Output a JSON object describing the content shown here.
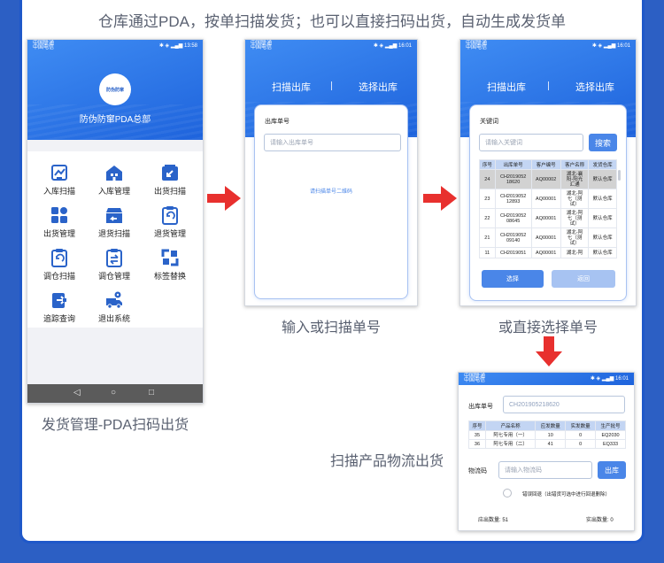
{
  "headline": "仓库通过PDA，按单扫描发货；也可以直接扫码出货，自动生成发货单",
  "colors": {
    "brand_blue": "#1f58c9",
    "accent_red": "#e8302e",
    "button_blue": "#4a86e8"
  },
  "captions": {
    "phone1": "发货管理-PDA扫码出货",
    "phone2": "输入或扫描单号",
    "phone3": "或直接选择单号",
    "phone4": "扫描产品物流出货"
  },
  "phone1": {
    "status_left1": "中国联通",
    "status_left2": "中国电信",
    "status_right": "✱ ◈ ▂▄▆ 13:58",
    "logo_text": "防伪防窜",
    "org_name": "防伪防窜PDA总部",
    "menu": [
      {
        "label": "入库扫描",
        "icon": "inbound-scan-icon"
      },
      {
        "label": "入库管理",
        "icon": "warehouse-icon"
      },
      {
        "label": "出货扫描",
        "icon": "outbound-scan-icon"
      },
      {
        "label": "出货管理",
        "icon": "grid-icon"
      },
      {
        "label": "退货扫描",
        "icon": "return-box-icon"
      },
      {
        "label": "退货管理",
        "icon": "return-clipboard-icon"
      },
      {
        "label": "调仓扫描",
        "icon": "transfer-scan-icon"
      },
      {
        "label": "调仓管理",
        "icon": "transfer-manage-icon"
      },
      {
        "label": "标签替换",
        "icon": "label-replace-icon"
      },
      {
        "label": "追踪查询",
        "icon": "trace-icon"
      },
      {
        "label": "退出系统",
        "icon": "truck-icon"
      }
    ],
    "nav": {
      "back": "◁",
      "home": "○",
      "recent": "□"
    }
  },
  "phone2": {
    "status_left1": "中国联通",
    "status_left2": "中国电信",
    "status_right": "✱ ◈ ▂▄▆ 16:01",
    "tab_scan": "扫描出库",
    "tab_select": "选择出库",
    "field_label": "出库单号",
    "field_placeholder": "请输入出库单号",
    "hint": "请扫描单号二维码"
  },
  "phone3": {
    "status_left1": "中国联通",
    "status_left2": "中国电信",
    "status_right": "✱ ◈ ▂▄▆ 16:01",
    "tab_scan": "扫描出库",
    "tab_select": "选择出库",
    "keyword_label": "关键词",
    "keyword_placeholder": "请输入关键词",
    "search_label": "搜索",
    "columns": [
      "序号",
      "出库单号",
      "客户编号",
      "客户名称",
      "发货仓库"
    ],
    "rows": [
      {
        "no": "24",
        "order_a": "CH2019052",
        "order_b": "18620",
        "cust_no": "AQ00002",
        "name_a": "湖北-襄",
        "name_b": "阳-阳光",
        "name_c": "汇通",
        "wh": "默认仓库"
      },
      {
        "no": "23",
        "order_a": "CH2019052",
        "order_b": "12893",
        "cust_no": "AQ00001",
        "name_a": "湖北-阿",
        "name_b": "七（测",
        "name_c": "试）",
        "wh": "默认仓库"
      },
      {
        "no": "22",
        "order_a": "CH2019052",
        "order_b": "08645",
        "cust_no": "AQ00001",
        "name_a": "湖北-阿",
        "name_b": "七（测",
        "name_c": "试）",
        "wh": "默认仓库"
      },
      {
        "no": "21",
        "order_a": "CH2019052",
        "order_b": "09140",
        "cust_no": "AQ00001",
        "name_a": "湖北-阿",
        "name_b": "七（测",
        "name_c": "试）",
        "wh": "默认仓库"
      },
      {
        "no": "11",
        "order_a": "CH2019051",
        "order_b": "",
        "cust_no": "AQ00001",
        "name_a": "湖北-阿",
        "name_b": "",
        "name_c": "",
        "wh": "默认仓库"
      }
    ],
    "select_label": "选择",
    "back_label": "返回"
  },
  "phone4": {
    "status_left1": "中国联通",
    "status_left2": "中国电信",
    "status_right": "✱ ◈ ▂▄▆ 16:01",
    "order_label": "出库单号",
    "order_value": "CH201905218620",
    "columns": [
      "序号",
      "产品名称",
      "应发数量",
      "实发数量",
      "生产批号"
    ],
    "rows": [
      {
        "no": "35",
        "name": "阿七专用（一）",
        "due": "10",
        "actual": "0",
        "batch": "EQ2030"
      },
      {
        "no": "36",
        "name": "阿七专用（二）",
        "due": "41",
        "actual": "0",
        "batch": "EQ333"
      }
    ],
    "code_label": "物流码",
    "code_placeholder": "请输入物流码",
    "outbound_label": "出库",
    "radio_label": "错误回退（出错货可选中进行回退删除）",
    "due_total": "应出数量: 51",
    "actual_total": "实出数量: 0"
  }
}
